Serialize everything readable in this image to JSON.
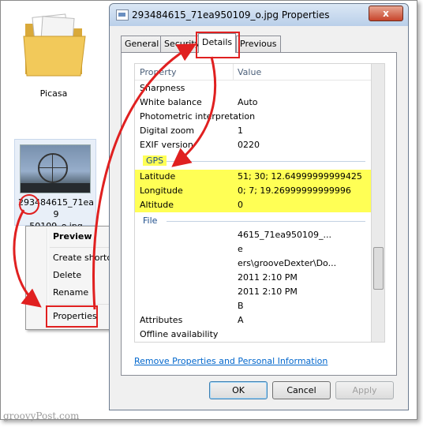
{
  "desktop": {
    "folder_label": "Picasa",
    "file_name": "293484615_71ea950109_o.jpg",
    "file_name_line1": "293484615_71ea9",
    "file_name_line2": "50109_o.jpg"
  },
  "context_menu": {
    "items": [
      "Preview",
      "Create shortcut",
      "Delete",
      "Rename",
      "Properties"
    ]
  },
  "dialog": {
    "title": "293484615_71ea950109_o.jpg Properties",
    "close_label": "x",
    "tabs": [
      "General",
      "Security",
      "Details",
      "Previous Versions"
    ],
    "active_tab": "Details",
    "columns": {
      "property": "Property",
      "value": "Value"
    },
    "rows_top": [
      {
        "property": "Sharpness",
        "value": ""
      },
      {
        "property": "White balance",
        "value": "Auto"
      },
      {
        "property": "Photometric interpretation",
        "value": ""
      },
      {
        "property": "Digital zoom",
        "value": "1"
      },
      {
        "property": "EXIF version",
        "value": "0220"
      }
    ],
    "gps_group": "GPS",
    "gps_rows": [
      {
        "property": "Latitude",
        "value": "51; 30; 12.64999999999425"
      },
      {
        "property": "Longitude",
        "value": "0; 7; 19.26999999999996"
      },
      {
        "property": "Altitude",
        "value": "0"
      }
    ],
    "file_group": "File",
    "file_rows_partial": [
      {
        "property": "",
        "value": "4615_71ea950109_..."
      },
      {
        "property": "",
        "value": "e"
      },
      {
        "property": "",
        "value": "ers\\grooveDexter\\Do..."
      },
      {
        "property": "",
        "value": "2011 2:10 PM"
      },
      {
        "property": "",
        "value": "2011 2:10 PM"
      },
      {
        "property": "",
        "value": "B"
      },
      {
        "property": "Attributes",
        "value": "A"
      },
      {
        "property": "Offline availability",
        "value": ""
      }
    ],
    "remove_link": "Remove Properties and Personal Information",
    "buttons": {
      "ok": "OK",
      "cancel": "Cancel",
      "apply": "Apply"
    }
  },
  "watermark": "groovyPost.com",
  "colors": {
    "highlight": "#ffff55",
    "annotation": "#e02020",
    "link": "#0066cc"
  }
}
